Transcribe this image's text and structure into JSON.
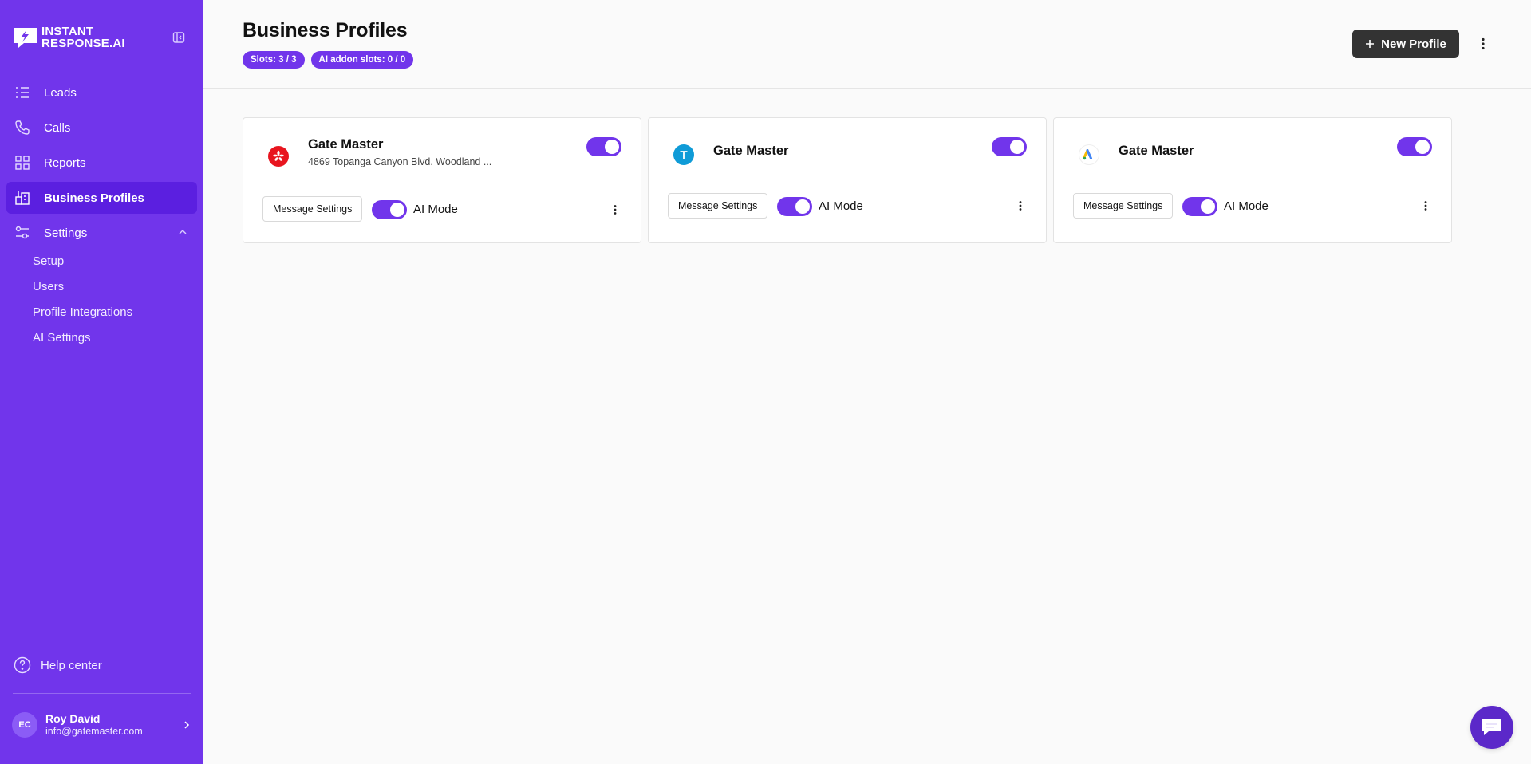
{
  "brand": {
    "line1": "INSTANT",
    "line2": "RESPONSE.AI",
    "color": "#7135eb"
  },
  "sidebar": {
    "items": [
      {
        "label": "Leads",
        "icon": "list-icon"
      },
      {
        "label": "Calls",
        "icon": "phone-icon"
      },
      {
        "label": "Reports",
        "icon": "grid-icon"
      },
      {
        "label": "Business Profiles",
        "icon": "buildings-icon",
        "active": true
      },
      {
        "label": "Settings",
        "icon": "sliders-icon",
        "expanded": true
      }
    ],
    "settings_sub": [
      "Setup",
      "Users",
      "Profile Integrations",
      "AI Settings"
    ],
    "help": "Help center",
    "user": {
      "initials": "EC",
      "name": "Roy David",
      "email": "info@gatemaster.com"
    }
  },
  "header": {
    "title": "Business Profiles",
    "badges": [
      "Slots: 3 / 3",
      "AI addon slots: 0 / 0"
    ],
    "new_button": "New Profile"
  },
  "cards": [
    {
      "name": "Gate Master",
      "address": "4869 Topanga Canyon Blvd. Woodland ...",
      "source_icon": "yelp-icon",
      "enabled": true,
      "message_settings": "Message Settings",
      "ai_mode_label": "AI Mode",
      "ai_mode": true
    },
    {
      "name": "Gate Master",
      "address": "",
      "source_icon": "thumbtack-icon",
      "enabled": true,
      "message_settings": "Message Settings",
      "ai_mode_label": "AI Mode",
      "ai_mode": true
    },
    {
      "name": "Gate Master",
      "address": "",
      "source_icon": "google-ads-icon",
      "enabled": true,
      "message_settings": "Message Settings",
      "ai_mode_label": "AI Mode",
      "ai_mode": true
    }
  ]
}
